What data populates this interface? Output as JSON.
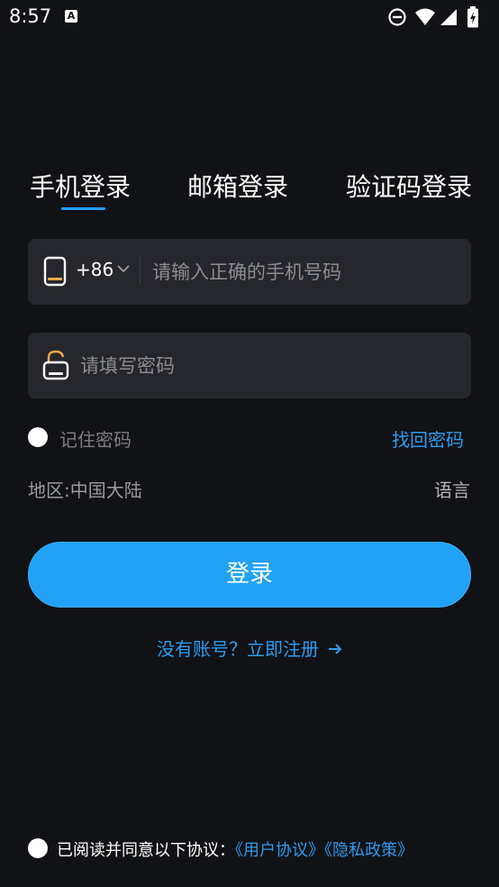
{
  "status_bar": {
    "time": "8:57",
    "icons": [
      "text-accessibility-icon",
      "do-not-disturb-icon",
      "wifi-icon",
      "cellular-signal-icon",
      "battery-charging-icon"
    ]
  },
  "tabs": [
    {
      "label": "手机登录",
      "active": true
    },
    {
      "label": "邮箱登录",
      "active": false
    },
    {
      "label": "验证码登录",
      "active": false
    }
  ],
  "phone": {
    "country_code": "+86",
    "placeholder": "请输入正确的手机号码",
    "value": ""
  },
  "password": {
    "placeholder": "请填写密码",
    "value": ""
  },
  "remember": {
    "label": "记住密码",
    "checked": false
  },
  "forgot_password": "找回密码",
  "region": "地区:中国大陆",
  "language": "语言",
  "login_button": "登录",
  "register_link": "没有账号？立即注册",
  "agreement": {
    "prefix": "已阅读并同意以下协议：",
    "user_agreement": "《用户协议》",
    "privacy_policy": "《隐私政策》",
    "checked": false
  },
  "colors": {
    "background": "#111215",
    "field": "#26272c",
    "accent": "#21a2f7",
    "link": "#2c9cf2",
    "icon_orange": "#f4a94b"
  }
}
